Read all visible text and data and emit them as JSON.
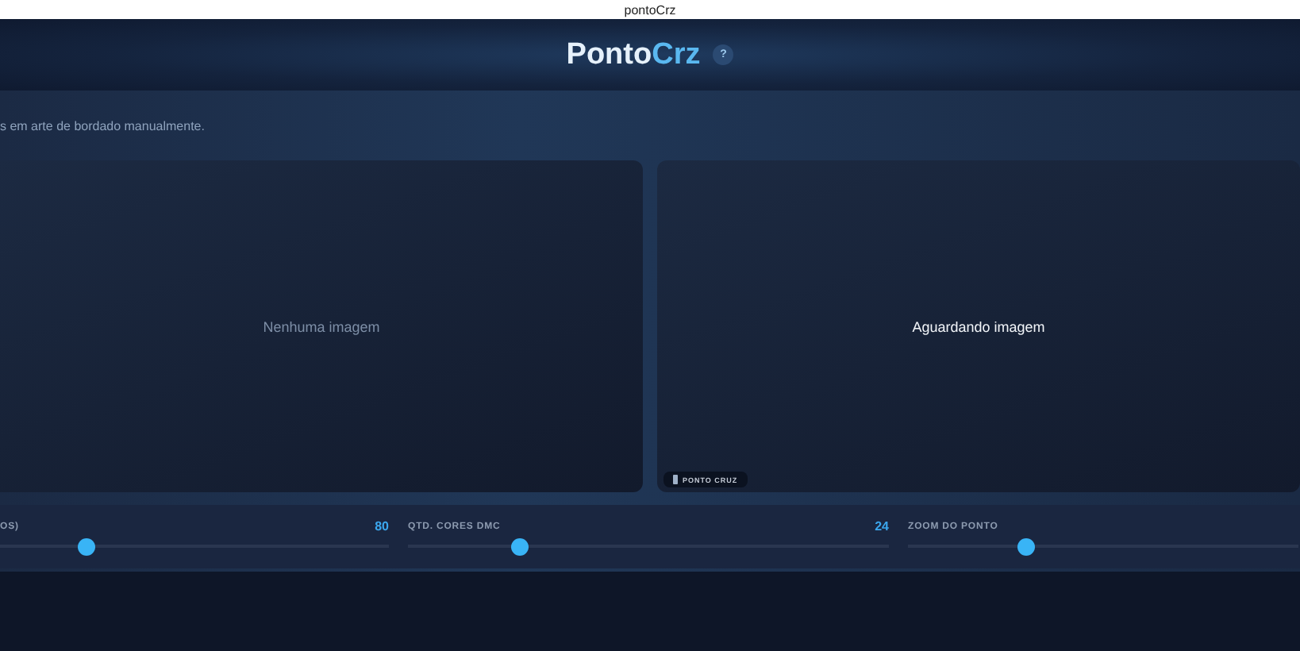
{
  "window": {
    "title": "pontoCrz"
  },
  "header": {
    "logo_parts": [
      "Ponto",
      "Crz"
    ],
    "help": "?"
  },
  "subtitle": "s em arte de bordado manualmente.",
  "panels": [
    {
      "kind": "input",
      "message": "Nenhuma imagem"
    },
    {
      "kind": "output",
      "message": "Aguardando imagem",
      "badge": "PONTO CRUZ"
    }
  ],
  "sliders": [
    {
      "label": "OS)",
      "value": "80",
      "level": 0.22
    },
    {
      "label": "QTD. CORES DMC",
      "value": "24",
      "level": 0.23
    },
    {
      "label": "ZOOM DO PONTO",
      "level": 0.3
    }
  ]
}
